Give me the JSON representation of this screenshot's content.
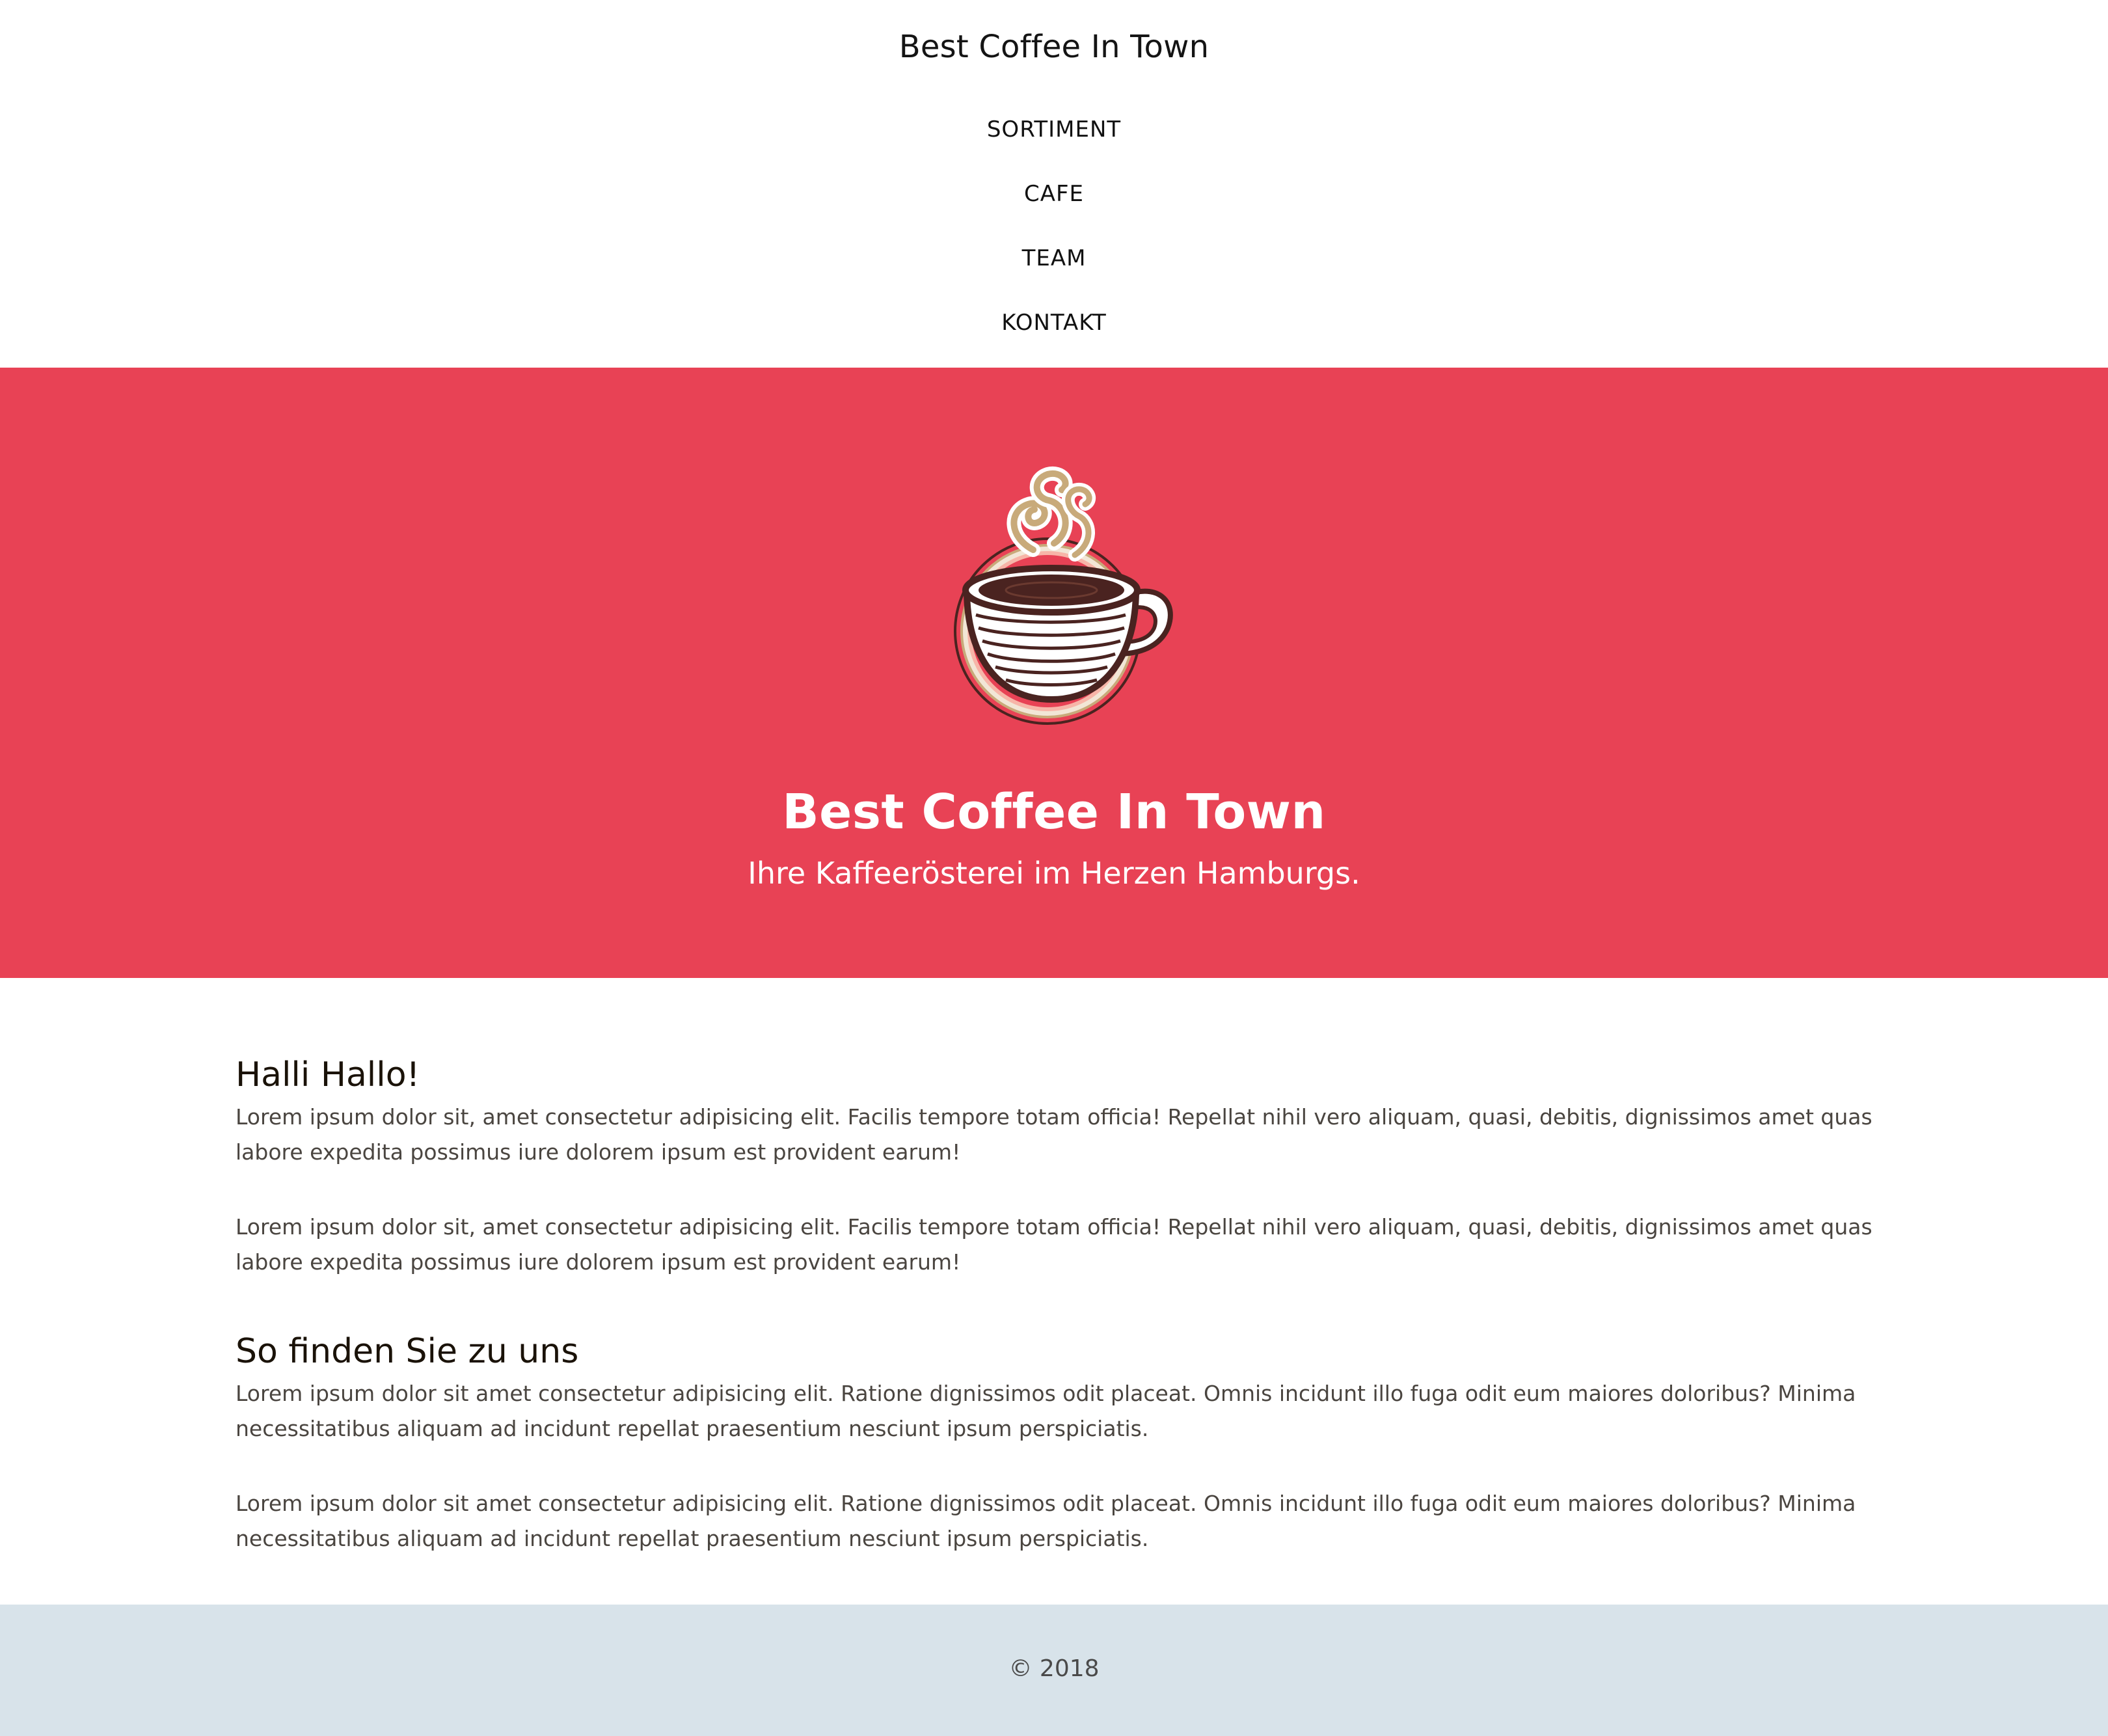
{
  "header": {
    "brand": "Best Coffee In Town",
    "nav": [
      "SORTIMENT",
      "CAFE",
      "TEAM",
      "KONTAKT"
    ]
  },
  "hero": {
    "logo_icon": "coffee-cup-logo-icon",
    "title": "Best Coffee In Town",
    "subtitle": "Ihre Kaffeerösterei im Herzen Hamburgs.",
    "background": "#e84255"
  },
  "sections": [
    {
      "heading": "Halli Hallo!",
      "paragraphs": [
        "Lorem ipsum dolor sit, amet consectetur adipisicing elit. Facilis tempore totam officia! Repellat nihil vero aliquam, quasi, debitis, dignissimos amet quas labore expedita possimus iure dolorem ipsum est provident earum!",
        "Lorem ipsum dolor sit, amet consectetur adipisicing elit. Facilis tempore totam officia! Repellat nihil vero aliquam, quasi, debitis, dignissimos amet quas labore expedita possimus iure dolorem ipsum est provident earum!"
      ]
    },
    {
      "heading": "So finden Sie zu uns",
      "paragraphs": [
        "Lorem ipsum dolor sit amet consectetur adipisicing elit. Ratione dignissimos odit placeat. Omnis incidunt illo fuga odit eum maiores doloribus? Minima necessitatibus aliquam ad incidunt repellat praesentium nesciunt ipsum perspiciatis.",
        "Lorem ipsum dolor sit amet consectetur adipisicing elit. Ratione dignissimos odit placeat. Omnis incidunt illo fuga odit eum maiores doloribus? Minima necessitatibus aliquam ad incidunt repellat praesentium nesciunt ipsum perspiciatis."
      ]
    }
  ],
  "footer": {
    "copyright": "© 2018",
    "background": "#d8e3ea"
  }
}
